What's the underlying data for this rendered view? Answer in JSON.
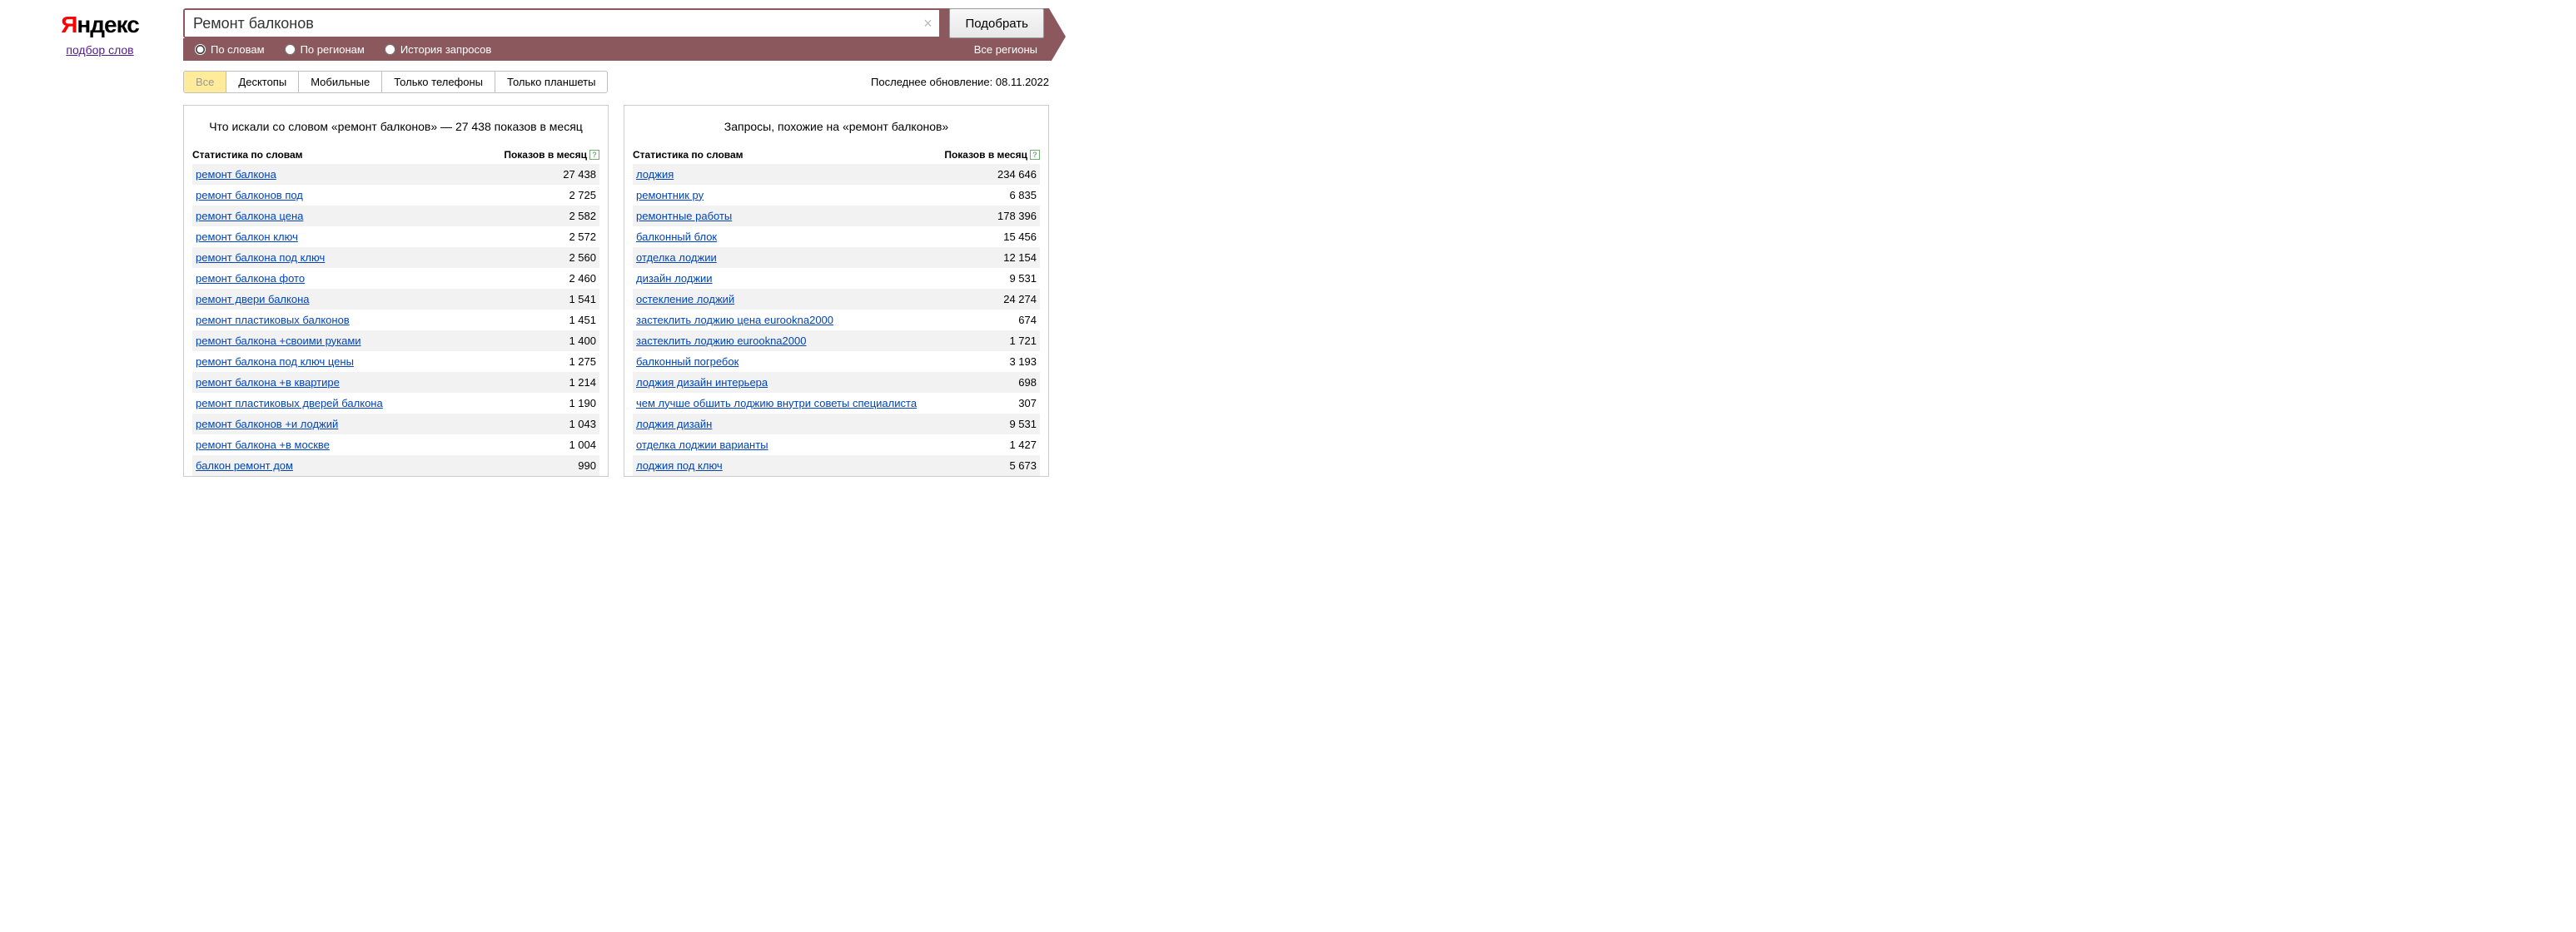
{
  "logo_text": "ндекс",
  "logo_y": "Я",
  "subtitle": "подбор слов",
  "search": {
    "value": "Ремонт балконов",
    "button": "Подобрать"
  },
  "opts": {
    "by_words": "По словам",
    "by_regions": "По регионам",
    "history": "История запросов",
    "regions": "Все регионы"
  },
  "tabs": {
    "all": "Все",
    "desktop": "Десктопы",
    "mobile": "Мобильные",
    "phones": "Только телефоны",
    "tablets": "Только планшеты"
  },
  "last_update": "Последнее обновление: 08.11.2022",
  "cols": {
    "stat": "Статистика по словам",
    "shows": "Показов в месяц"
  },
  "left": {
    "title": "Что искали со словом «ремонт балконов» — 27 438 показов в месяц",
    "rows": [
      {
        "q": "ремонт балкона",
        "v": "27 438"
      },
      {
        "q": "ремонт балконов под",
        "v": "2 725"
      },
      {
        "q": "ремонт балкона цена",
        "v": "2 582"
      },
      {
        "q": "ремонт балкон ключ",
        "v": "2 572"
      },
      {
        "q": "ремонт балкона под ключ",
        "v": "2 560"
      },
      {
        "q": "ремонт балкона фото",
        "v": "2 460"
      },
      {
        "q": "ремонт двери балкона",
        "v": "1 541"
      },
      {
        "q": "ремонт пластиковых балконов",
        "v": "1 451"
      },
      {
        "q": "ремонт балкона +своими руками",
        "v": "1 400"
      },
      {
        "q": "ремонт балкона под ключ цены",
        "v": "1 275"
      },
      {
        "q": "ремонт балкона +в квартире",
        "v": "1 214"
      },
      {
        "q": "ремонт пластиковых дверей балкона",
        "v": "1 190"
      },
      {
        "q": "ремонт балконов +и лоджий",
        "v": "1 043"
      },
      {
        "q": "ремонт балкона +в москве",
        "v": "1 004"
      },
      {
        "q": "балкон ремонт дом",
        "v": "990"
      }
    ]
  },
  "right": {
    "title": "Запросы, похожие на «ремонт балконов»",
    "rows": [
      {
        "q": "лоджия",
        "v": "234 646"
      },
      {
        "q": "ремонтник ру",
        "v": "6 835"
      },
      {
        "q": "ремонтные работы",
        "v": "178 396"
      },
      {
        "q": "балконный блок",
        "v": "15 456"
      },
      {
        "q": "отделка лоджии",
        "v": "12 154"
      },
      {
        "q": "дизайн лоджии",
        "v": "9 531"
      },
      {
        "q": "остекление лоджий",
        "v": "24 274"
      },
      {
        "q": "застеклить лоджию цена eurookna2000",
        "v": "674"
      },
      {
        "q": "застеклить лоджию eurookna2000",
        "v": "1 721"
      },
      {
        "q": "балконный погребок",
        "v": "3 193"
      },
      {
        "q": "лоджия дизайн интерьера",
        "v": "698"
      },
      {
        "q": "чем лучше обшить лоджию внутри советы специалиста",
        "v": "307"
      },
      {
        "q": "лоджия дизайн",
        "v": "9 531"
      },
      {
        "q": "отделка лоджии варианты",
        "v": "1 427"
      },
      {
        "q": "лоджия под ключ",
        "v": "5 673"
      }
    ]
  }
}
